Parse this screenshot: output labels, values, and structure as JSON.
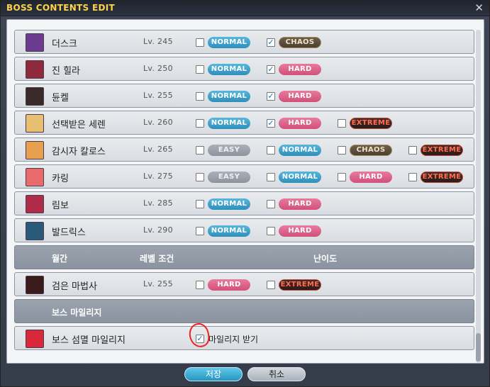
{
  "window": {
    "title": "BOSS CONTENTS EDIT",
    "close_icon": "close-icon"
  },
  "lv_prefix": "Lv.",
  "bosses": [
    {
      "name": "더스크",
      "level": "Lv. 245",
      "portrait_color": "#6a3b8f"
    },
    {
      "name": "진 힐라",
      "level": "Lv. 250",
      "portrait_color": "#8f2a3d"
    },
    {
      "name": "듄켈",
      "level": "Lv. 255",
      "portrait_color": "#3a2a2a"
    },
    {
      "name": "선택받은 세렌",
      "level": "Lv. 260",
      "portrait_color": "#e6c070"
    },
    {
      "name": "감시자 칼로스",
      "level": "Lv. 265",
      "portrait_color": "#e6a050"
    },
    {
      "name": "카링",
      "level": "Lv. 275",
      "portrait_color": "#e86a6a"
    },
    {
      "name": "림보",
      "level": "Lv. 285",
      "portrait_color": "#b02a4a"
    },
    {
      "name": "발드릭스",
      "level": "Lv. 290",
      "portrait_color": "#2a5a7a"
    }
  ],
  "badges": {
    "normal": "NORMAL",
    "hard": "HARD",
    "easy": "EASY",
    "chaos": "CHAOS",
    "extreme": "EXTREME"
  },
  "monthly_header": {
    "col1": "월간",
    "col2": "레벨 조건",
    "col3": "난이도"
  },
  "monthly_boss": {
    "name": "검은 마법사",
    "level": "Lv. 255"
  },
  "mileage_header": {
    "col1": "보스 마일리지"
  },
  "mileage_row": {
    "name": "보스 섬멸 마일리지",
    "label": "마일리지 받기"
  },
  "buttons": {
    "ok": "저장",
    "cancel": "취소"
  },
  "checkmark": "✓"
}
